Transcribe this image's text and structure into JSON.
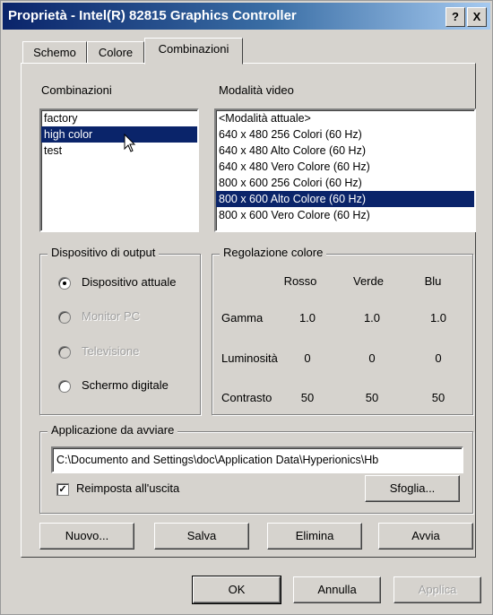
{
  "window": {
    "title": "Proprietà - Intel(R) 82815 Graphics Controller",
    "help_button": "?",
    "close_button": "X"
  },
  "tabs": [
    {
      "label": "Schemo",
      "active": false
    },
    {
      "label": "Colore",
      "active": false
    },
    {
      "label": "Combinazioni",
      "active": true
    }
  ],
  "combinations": {
    "label": "Combinazioni",
    "items": [
      "factory",
      "high color",
      "test"
    ],
    "selected": "high color"
  },
  "video_modes": {
    "label": "Modalità video",
    "items": [
      "<Modalità attuale>",
      "640 x 480 256 Colori (60 Hz)",
      "640 x 480 Alto Colore (60 Hz)",
      "640 x 480 Vero Colore (60 Hz)",
      "800 x 600 256 Colori (60 Hz)",
      "800 x 600 Alto Colore (60 Hz)",
      "800 x 600 Vero Colore (60 Hz)"
    ],
    "selected": "800 x 600 Alto Colore (60 Hz)"
  },
  "output_device": {
    "label": "Dispositivo di output",
    "options": [
      {
        "label": "Dispositivo attuale",
        "checked": true,
        "enabled": true
      },
      {
        "label": "Monitor PC",
        "checked": false,
        "enabled": false
      },
      {
        "label": "Televisione",
        "checked": false,
        "enabled": false
      },
      {
        "label": "Schermo digitale",
        "checked": false,
        "enabled": true
      }
    ]
  },
  "color_adjust": {
    "label": "Regolazione colore",
    "columns": [
      "Rosso",
      "Verde",
      "Blu"
    ],
    "rows": [
      {
        "label": "Gamma",
        "values": [
          "1.0",
          "1.0",
          "1.0"
        ]
      },
      {
        "label": "Luminosità",
        "values": [
          "0",
          "0",
          "0"
        ]
      },
      {
        "label": "Contrasto",
        "values": [
          "50",
          "50",
          "50"
        ]
      }
    ]
  },
  "app_launch": {
    "label": "Applicazione da avviare",
    "path": "C:\\Documento and Settings\\doc\\Application Data\\Hyperionics\\Hb",
    "reset_label": "Reimposta all'uscita",
    "reset_checked": true,
    "browse_label": "Sfoglia..."
  },
  "actions": {
    "new": "Nuovo...",
    "save": "Salva",
    "delete": "Elimina",
    "start": "Avvia"
  },
  "footer": {
    "ok": "OK",
    "cancel": "Annulla",
    "apply": "Applica"
  },
  "colors": {
    "selection": "#0a246a",
    "face": "#d6d3ce"
  }
}
